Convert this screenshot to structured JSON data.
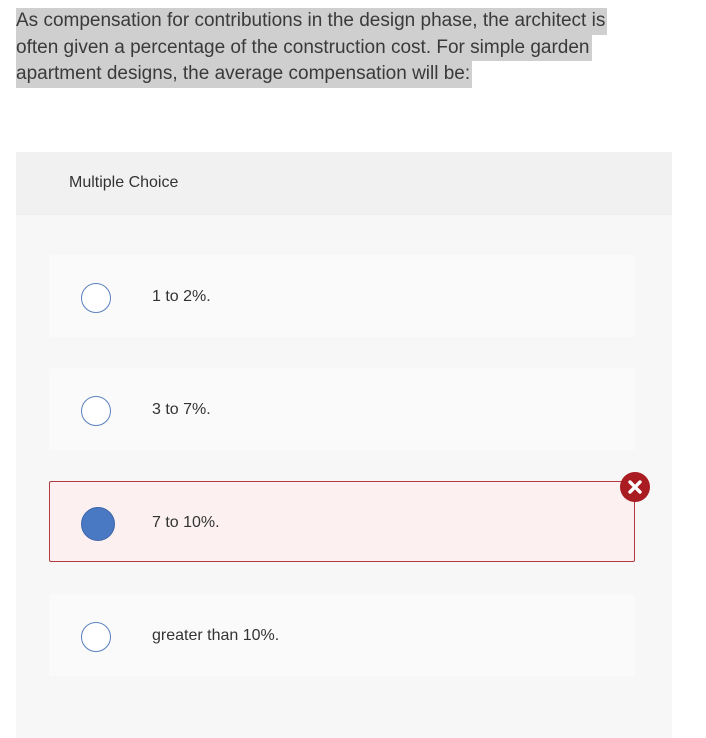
{
  "question": {
    "lines": [
      "As compensation for contributions in the design phase, the architect is",
      "often given a percentage of the construction cost. For simple garden",
      "apartment designs, the average compensation will be:"
    ]
  },
  "card": {
    "header": "Multiple Choice",
    "options": [
      {
        "label": "1 to 2%.",
        "selected": false,
        "state": "neutral"
      },
      {
        "label": "3 to 7%.",
        "selected": false,
        "state": "neutral"
      },
      {
        "label": "7 to 10%.",
        "selected": true,
        "state": "incorrect"
      },
      {
        "label": "greater than 10%.",
        "selected": false,
        "state": "neutral"
      }
    ]
  },
  "colors": {
    "radio_border": "#5a7fbf",
    "radio_selected": "#4a79c4",
    "incorrect_border": "#b23a3e",
    "incorrect_bg": "#fcf0f1",
    "incorrect_icon": "#a81c22"
  },
  "icons": {
    "incorrect": "x-circle-icon"
  }
}
